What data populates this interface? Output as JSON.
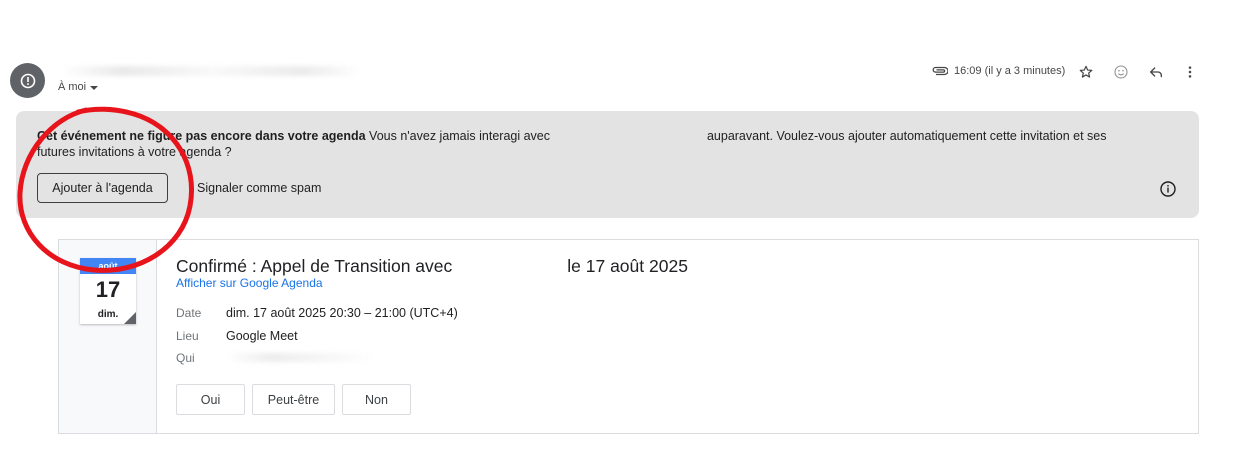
{
  "header": {
    "to_me_label": "À moi",
    "timestamp": "16:09 (il y a 3 minutes)"
  },
  "banner": {
    "title_bold": "Cet événement ne figure pas encore dans votre agenda",
    "text_before_gap": " Vous n'avez jamais interagi avec ",
    "text_after_gap": " auparavant. Voulez-vous ajouter automatiquement cette invitation et ses futures invitations à votre agenda ?",
    "add_button_label": "Ajouter à l'agenda",
    "spam_link_label": "Signaler comme spam"
  },
  "event": {
    "calendar_month": "août",
    "calendar_day": "17",
    "calendar_weekday": "dim.",
    "title_part1": "Confirmé : Appel de Transition avec",
    "title_part2": "le 17 août 2025",
    "view_link": "Afficher sur Google Agenda",
    "date_label": "Date",
    "date_value": "dim. 17 août 2025 20:30 – 21:00 (UTC+4)",
    "location_label": "Lieu",
    "location_value": "Google Meet",
    "who_label": "Qui",
    "rsvp": {
      "yes": "Oui",
      "maybe": "Peut-être",
      "no": "Non"
    }
  },
  "icons": {
    "avatar": "alert-icon",
    "attachment": "paperclip-icon",
    "star": "star-icon",
    "emoji": "emoji-icon",
    "reply": "reply-icon",
    "more": "more-vert-icon",
    "info": "info-icon"
  },
  "colors": {
    "banner_bg": "#e3e3e3",
    "link_blue": "#1a73e8",
    "calendar_blue": "#4285f4",
    "annotation_red": "#e8141b"
  }
}
